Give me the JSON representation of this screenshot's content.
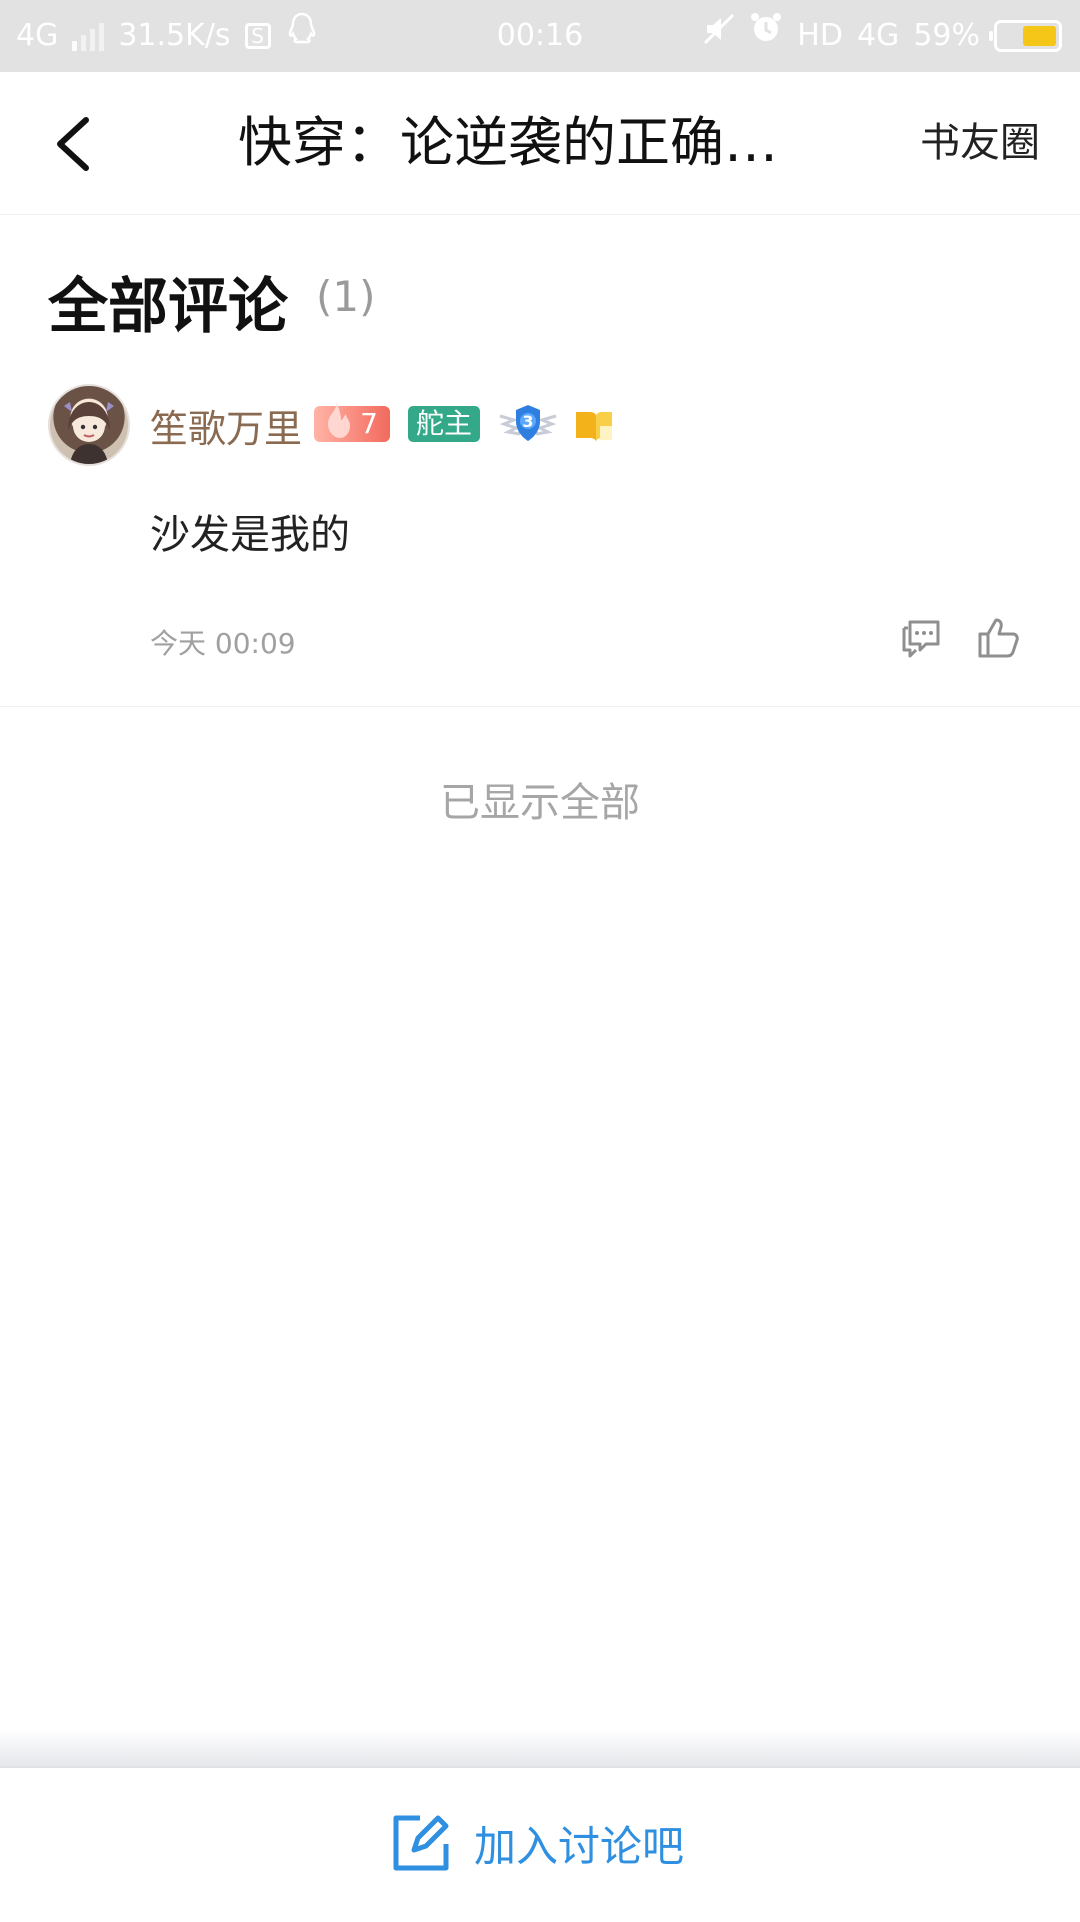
{
  "status_bar": {
    "network": "4G",
    "speed": "31.5K/s",
    "time": "00:16",
    "hd": "HD",
    "network_right": "4G",
    "battery": "59%",
    "battery_level": 0.59,
    "battery_color": "#f5c518"
  },
  "nav": {
    "title": "快穿：论逆袭的正确…",
    "right_link": "书友圈"
  },
  "comments": {
    "title": "全部评论",
    "count": "(1)",
    "items": [
      {
        "username": "笙歌万里",
        "fire_level": "7",
        "role_badge": "舵主",
        "shield_level": "3",
        "text": "沙发是我的",
        "time": "今天 00:09"
      }
    ],
    "end_note": "已显示全部"
  },
  "bottom": {
    "join_label": "加入讨论吧",
    "accent": "#2f8fe0"
  }
}
